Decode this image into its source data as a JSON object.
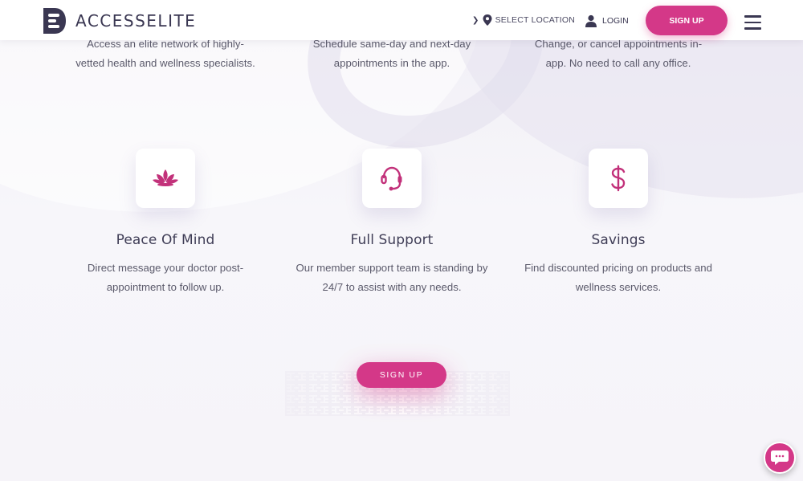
{
  "header": {
    "logo_text": "ACCESSELITE",
    "location_label": "SELECT LOCATION",
    "login_label": "LOGIN",
    "signup_label": "SIGN UP"
  },
  "top_row": [
    {
      "text": "Access an elite network of highly-vetted health and wellness specialists."
    },
    {
      "text": "Schedule same-day and next-day appointments in the app."
    },
    {
      "text": "Change, or cancel appointments in-app. No need to call any office."
    }
  ],
  "features": [
    {
      "icon": "lotus-icon",
      "title": "Peace Of Mind",
      "text": "Direct message your doctor post-appointment to follow up."
    },
    {
      "icon": "headset-icon",
      "title": "Full Support",
      "text": "Our member support team is standing by 24/7 to assist with any needs."
    },
    {
      "icon": "dollar-icon",
      "title": "Savings",
      "text": "Find discounted pricing on products and wellness services."
    }
  ],
  "cta": {
    "label": "SIGN UP"
  },
  "colors": {
    "accent": "#d43888",
    "dark": "#3a3752",
    "text": "#5b5a6b"
  }
}
